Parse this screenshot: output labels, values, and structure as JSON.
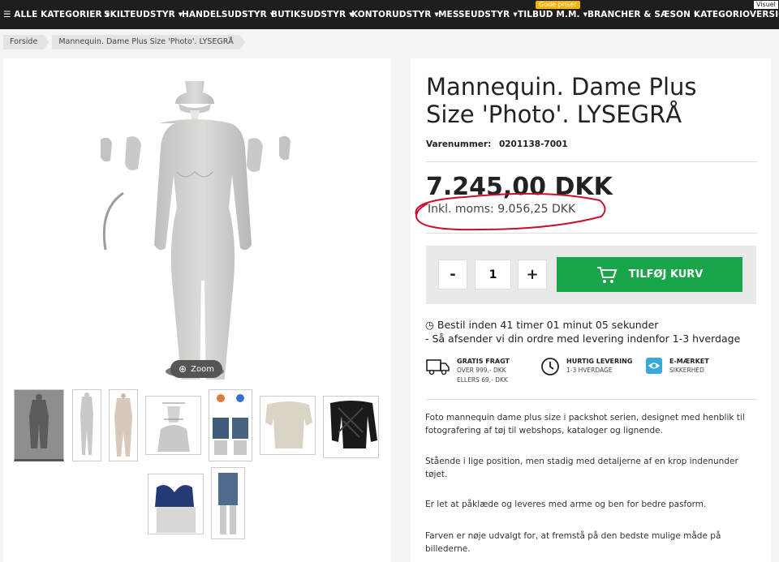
{
  "nav": {
    "items": [
      {
        "label": "☰ ALLE KATEGORIER"
      },
      {
        "label": "SKILTEUDSTYR"
      },
      {
        "label": "HANDELSUDSTYR"
      },
      {
        "label": "BUTIKSUDSTYR"
      },
      {
        "label": "KONTORUDSTYR"
      },
      {
        "label": "MESSEUDSTYR"
      },
      {
        "label": "TILBUD M.M."
      },
      {
        "label": "BRANCHER & SÆSON"
      },
      {
        "label": "KATEGORIOVERSIGT"
      }
    ],
    "badge_gode": "Gode priser",
    "badge_visuel": "Visuel"
  },
  "breadcrumb": [
    "Forside",
    "Mannequin. Dame Plus Size 'Photo'. LYSEGRÅ"
  ],
  "gallery": {
    "zoom_label": "Zoom"
  },
  "product": {
    "title": "Mannequin. Dame Plus Size 'Photo'. LYSEGRÅ",
    "sku_label": "Varenummer:",
    "sku": "0201138-7001",
    "price": "7.245,00 DKK",
    "vat_price": "Inkl. moms: 9.056,25 DKK",
    "qty_minus": "-",
    "qty": "1",
    "qty_plus": "+",
    "add_to_cart": "TILFØJ KURV",
    "deadline_line1": "Bestil inden 41 timer 01 minut 05 sekunder",
    "deadline_line2": "- Så afsender vi din ordre med levering indenfor 1-3 hverdage"
  },
  "usps": [
    {
      "title": "GRATIS FRAGT",
      "sub1": "OVER 999,- DKK",
      "sub2": "ELLERS 69,- DKK",
      "icon": "truck-icon"
    },
    {
      "title": "HURTIG LEVERING",
      "sub1": "1-3 HVERDAGE",
      "sub2": "",
      "icon": "clock-icon"
    },
    {
      "title": "E-MÆRKET",
      "sub1": "SIKKERHED",
      "sub2": "",
      "icon": "e-maerket-icon"
    }
  ],
  "description": [
    "Foto mannequin dame plus size i packshot serien, designet med henblik til fotografering af tøj til webshops, kataloger og lignende.",
    "Stående i lige position, men stadig med detaljerne af en krop indenunder tøjet.",
    "Er let at påklæde og leveres med arme og ben for bedre pasform.",
    "Farven er nøje udvalgt for, at fremstå på den bedste mulige måde på billederne."
  ],
  "colors": {
    "nav_bg": "#1e1e1e",
    "cart_green": "#19a64a",
    "annotation_red": "#c8102e",
    "badge_yellow": "#f4b400"
  }
}
